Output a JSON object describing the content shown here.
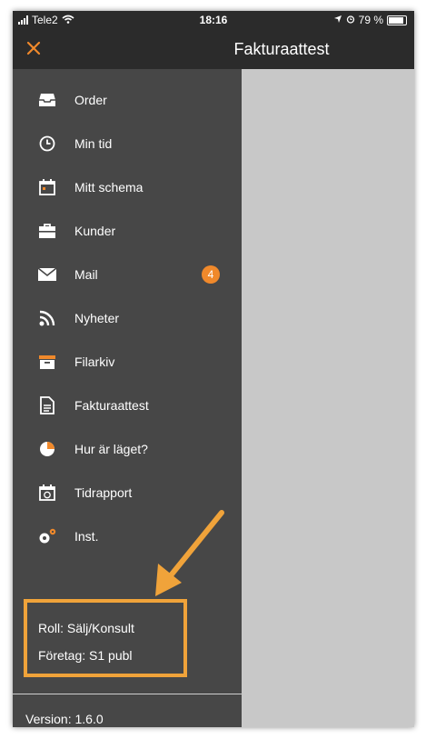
{
  "status_bar": {
    "carrier": "Tele2",
    "time": "18:16",
    "battery": "79 %"
  },
  "header": {
    "title": "Fakturaattest",
    "close_icon": "close-icon"
  },
  "menu": {
    "items": [
      {
        "label": "Order",
        "icon": "inbox-tray-icon"
      },
      {
        "label": "Min tid",
        "icon": "clock-icon"
      },
      {
        "label": "Mitt schema",
        "icon": "calendar-icon"
      },
      {
        "label": "Kunder",
        "icon": "briefcase-icon"
      },
      {
        "label": "Mail",
        "icon": "envelope-icon",
        "badge": "4"
      },
      {
        "label": "Nyheter",
        "icon": "rss-icon"
      },
      {
        "label": "Filarkiv",
        "icon": "archive-box-icon"
      },
      {
        "label": "Fakturaattest",
        "icon": "document-icon"
      },
      {
        "label": "Hur är läget?",
        "icon": "pie-chart-icon"
      },
      {
        "label": "Tidrapport",
        "icon": "calendar-clock-icon"
      },
      {
        "label": "Inst.",
        "icon": "gears-icon"
      }
    ]
  },
  "footer": {
    "role": "Roll: Sälj/Konsult",
    "company": "Företag: S1 publ",
    "version": "Version: 1.6.0"
  },
  "colors": {
    "accent": "#f0892b",
    "highlight_box": "#f0a33a",
    "drawer_bg": "#474747",
    "topbar_bg": "#2b2b2b",
    "content_bg": "#c8c8c8"
  }
}
